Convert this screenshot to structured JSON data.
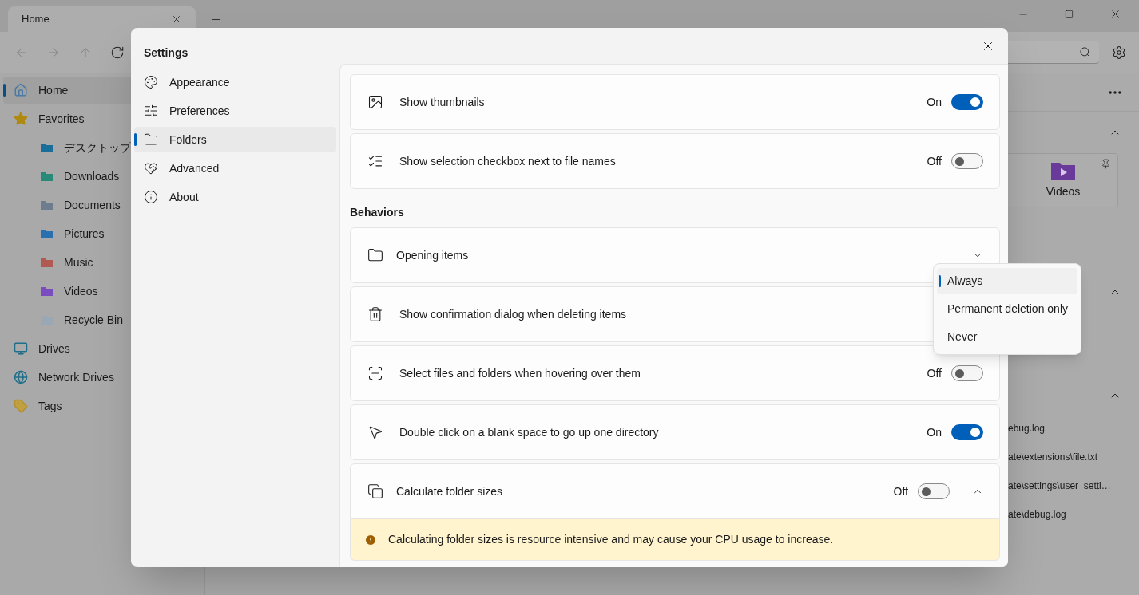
{
  "tab_bar": {
    "tabs": [
      {
        "label": "Home",
        "selected": true
      }
    ]
  },
  "sidebar": {
    "items": [
      {
        "label": "Home",
        "kind": "home",
        "selected": true
      },
      {
        "label": "Favorites",
        "kind": "star",
        "selected": false,
        "children": [
          {
            "label": "デスクトップ",
            "kind": "desktop",
            "selected": false
          },
          {
            "label": "Downloads",
            "kind": "downloads",
            "selected": false
          },
          {
            "label": "Documents",
            "kind": "documents",
            "selected": false
          },
          {
            "label": "Pictures",
            "kind": "pictures",
            "selected": false
          },
          {
            "label": "Music",
            "kind": "music",
            "selected": false
          },
          {
            "label": "Videos",
            "kind": "videos",
            "selected": false
          },
          {
            "label": "Recycle Bin",
            "kind": "bin",
            "selected": false
          }
        ]
      },
      {
        "label": "Drives",
        "kind": "drive",
        "selected": false
      },
      {
        "label": "Network Drives",
        "kind": "network",
        "selected": false
      },
      {
        "label": "Tags",
        "kind": "tag",
        "selected": false
      }
    ]
  },
  "main": {
    "pinned": [
      {
        "label": "Videos"
      }
    ],
    "recent_files": [
      "ebug.log",
      "ate\\extensions\\file.txt",
      "ate\\settings\\user_setti…",
      "ate\\debug.log"
    ]
  },
  "settings_dialog": {
    "title": "Settings",
    "nav": [
      {
        "label": "Appearance",
        "kind": "palette",
        "selected": false
      },
      {
        "label": "Preferences",
        "kind": "sliders",
        "selected": false
      },
      {
        "label": "Folders",
        "kind": "folder",
        "selected": true
      },
      {
        "label": "Advanced",
        "kind": "advanced",
        "selected": false
      },
      {
        "label": "About",
        "kind": "info",
        "selected": false
      }
    ],
    "items": [
      {
        "kind": "toggle",
        "label": "Show thumbnails",
        "on": true,
        "state_text": "On"
      },
      {
        "kind": "toggle",
        "label": "Show selection checkbox next to file names",
        "on": false,
        "state_text": "Off"
      },
      {
        "kind": "heading",
        "label": "Behaviors"
      },
      {
        "kind": "expander",
        "label": "Opening items",
        "expanded": false
      },
      {
        "kind": "dropdown",
        "label": "Show confirmation dialog when deleting items"
      },
      {
        "kind": "toggle",
        "label": "Select files and folders when hovering over them",
        "on": false,
        "state_text": "Off"
      },
      {
        "kind": "toggle",
        "label": "Double click on a blank space to go up one directory",
        "on": true,
        "state_text": "On"
      },
      {
        "kind": "expander_toggle",
        "label": "Calculate folder sizes",
        "on": false,
        "state_text": "Off",
        "expanded": true,
        "warning": "Calculating folder sizes is resource intensive and may cause your CPU usage to increase."
      }
    ]
  },
  "dropdown_menu": {
    "options": [
      {
        "label": "Always",
        "selected": true
      },
      {
        "label": "Permanent deletion only",
        "selected": false
      },
      {
        "label": "Never",
        "selected": false
      }
    ]
  }
}
